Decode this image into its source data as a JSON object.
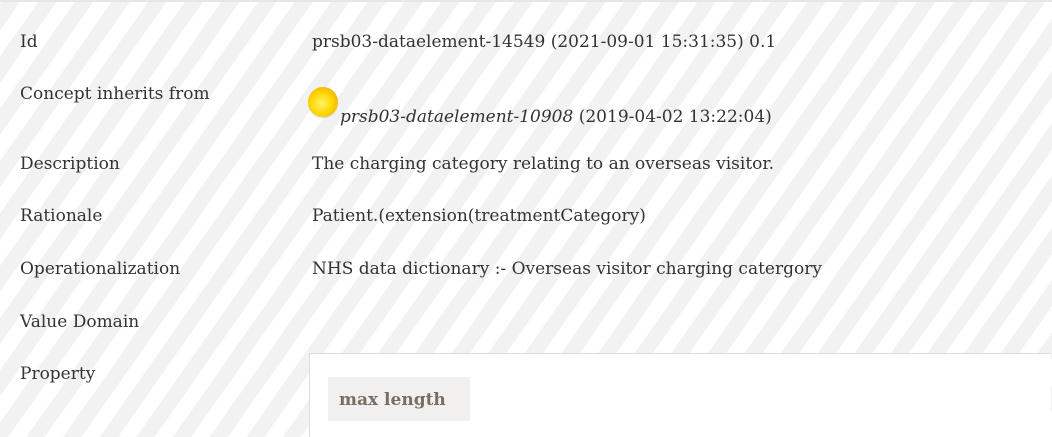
{
  "fields": {
    "id": {
      "label": "Id",
      "value": "prsb03-dataelement-14549 (2021-09-01 15:31:35) 0.1"
    },
    "inherits": {
      "label": "Concept inherits from",
      "ref_id": "prsb03-dataelement-10908",
      "ref_date": "(2019-04-02 13:22:04)",
      "status_icon": "yellow-circle-icon",
      "status_color": "#ffd800"
    },
    "description": {
      "label": "Description",
      "value": "The charging category relating to an overseas visitor."
    },
    "rationale": {
      "label": "Rationale",
      "value": "Patient.(extension(treatmentCategory)"
    },
    "operationalization": {
      "label": "Operationalization",
      "value": "NHS data dictionary :- Overseas visitor charging catergory"
    },
    "value_domain": {
      "label": "Value Domain"
    },
    "property": {
      "label": "Property",
      "column_header": "max length"
    }
  },
  "colors": {
    "text": "#333333",
    "stripe": "#f2f2f2",
    "property_header_bg": "#f2f0ee",
    "property_header_text": "#7a6e62"
  }
}
